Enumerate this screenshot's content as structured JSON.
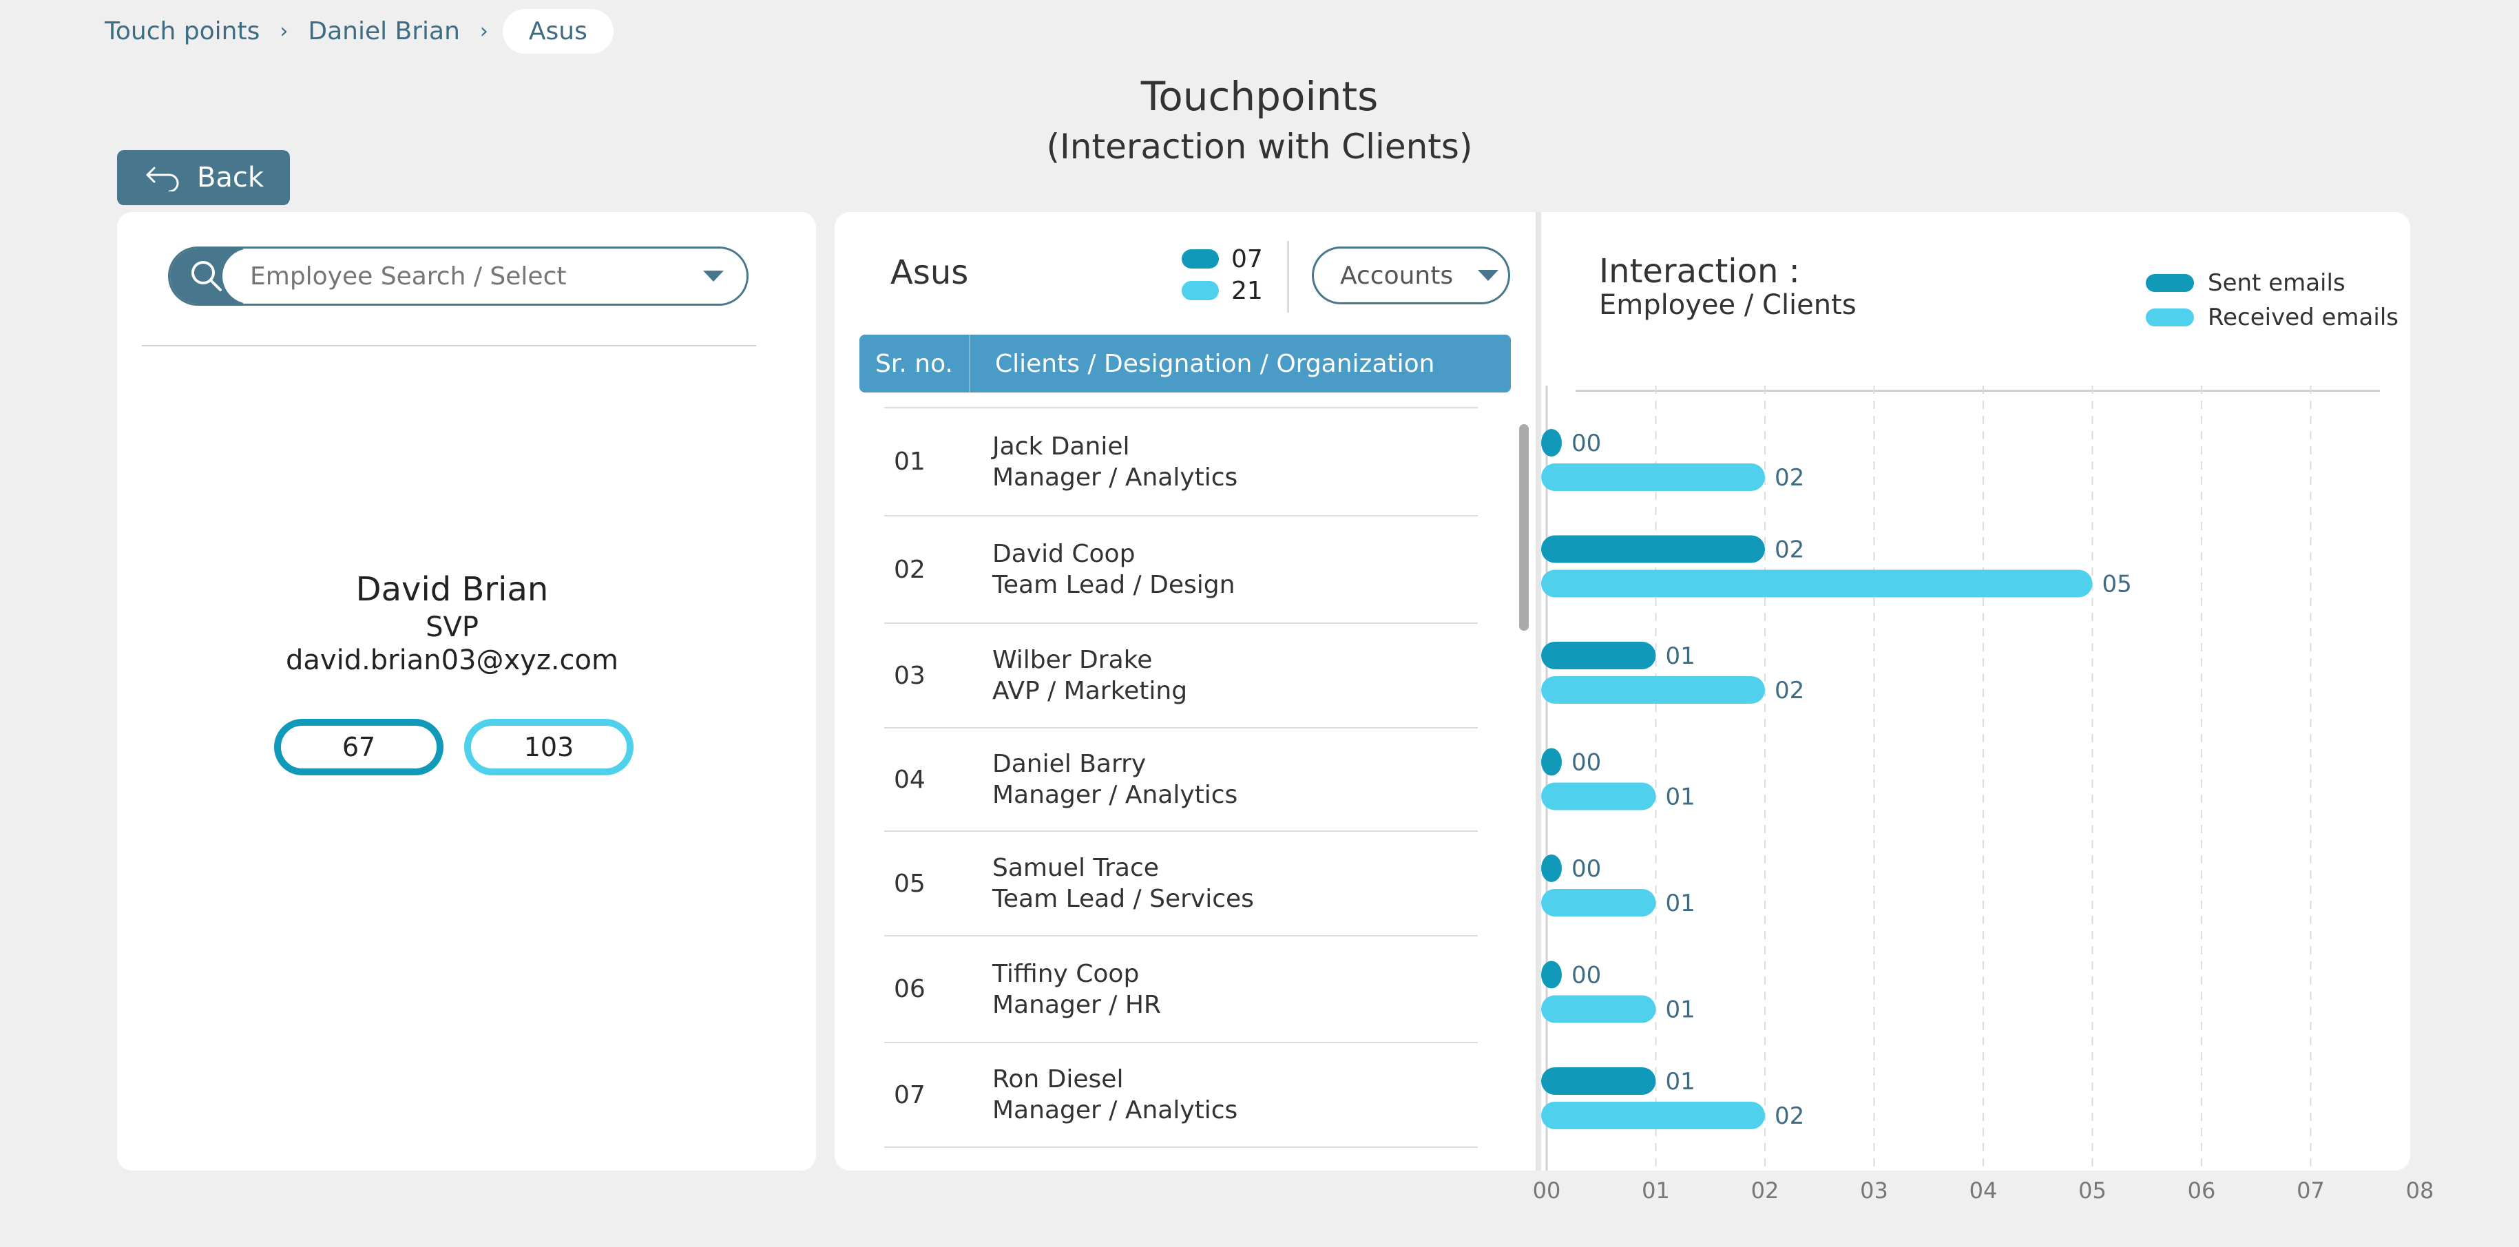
{
  "breadcrumb": {
    "items": [
      "Touch points",
      "Daniel Brian"
    ],
    "active": "Asus"
  },
  "header": {
    "title": "Touchpoints",
    "subtitle": "(Interaction with Clients)"
  },
  "back": {
    "label": "Back"
  },
  "left_panel": {
    "search_placeholder": "Employee Search / Select",
    "employee": {
      "name": "David Brian",
      "role": "SVP",
      "email": "david.brian03@xyz.com"
    },
    "sent_count": "67",
    "received_count": "103"
  },
  "middle_panel": {
    "org_name": "Asus",
    "legend": {
      "sent": "07",
      "received": "21"
    },
    "accounts_label": "Accounts",
    "table": {
      "headers": [
        "Sr. no.",
        "Clients / Designation / Organization"
      ],
      "rows": [
        {
          "sr": "01",
          "name": "Jack Daniel",
          "designation": "Manager / Analytics"
        },
        {
          "sr": "02",
          "name": "David Coop",
          "designation": "Team Lead / Design"
        },
        {
          "sr": "03",
          "name": "Wilber Drake",
          "designation": "AVP / Marketing"
        },
        {
          "sr": "04",
          "name": "Daniel Barry",
          "designation": "Manager / Analytics"
        },
        {
          "sr": "05",
          "name": "Samuel Trace",
          "designation": "Team Lead / Services"
        },
        {
          "sr": "06",
          "name": "Tiffiny Coop",
          "designation": "Manager / HR"
        },
        {
          "sr": "07",
          "name": "Ron Diesel",
          "designation": "Manager / Analytics"
        }
      ]
    }
  },
  "right_panel": {
    "title": "Interaction :",
    "subtitle": "Employee / Clients",
    "legend": {
      "sent": "Sent emails",
      "received": "Received emails"
    }
  },
  "colors": {
    "accent": "#47768d",
    "header_blue": "#4a9cc6",
    "sent": "#1199b9",
    "received": "#4fd1ee",
    "bar_label": "#3d6c83"
  },
  "chart_data": {
    "type": "bar",
    "orientation": "horizontal",
    "categories": [
      "01",
      "02",
      "03",
      "04",
      "05",
      "06",
      "07"
    ],
    "series": [
      {
        "name": "Sent emails",
        "values": [
          0,
          2,
          1,
          0,
          0,
          0,
          1
        ],
        "labels": [
          "00",
          "02",
          "01",
          "00",
          "00",
          "00",
          "01"
        ]
      },
      {
        "name": "Received emails",
        "values": [
          2,
          5,
          2,
          1,
          1,
          1,
          2
        ],
        "labels": [
          "02",
          "05",
          "02",
          "01",
          "01",
          "01",
          "02"
        ]
      }
    ],
    "x_ticks": [
      "00",
      "01",
      "02",
      "03",
      "04",
      "05",
      "06",
      "07",
      "08"
    ],
    "xlim": [
      0,
      8
    ],
    "grid": true,
    "legend": "top-right"
  }
}
